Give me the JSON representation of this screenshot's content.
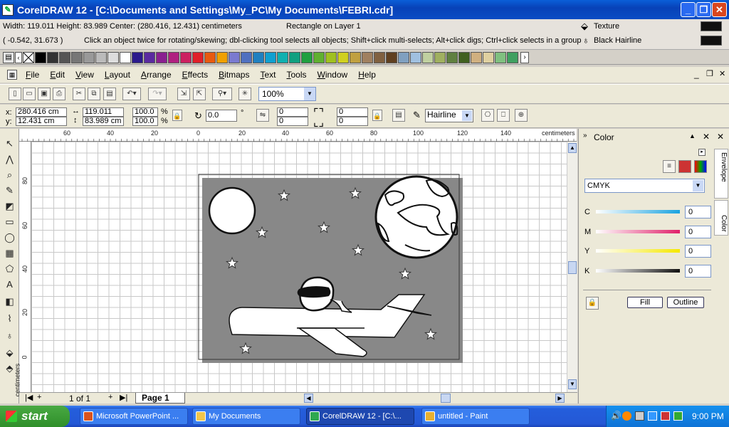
{
  "window": {
    "title": "CorelDRAW 12 - [C:\\Documents and Settings\\My_PC\\My Documents\\FEBRI.cdr]",
    "min": "_",
    "max": "❐",
    "close": "✕"
  },
  "status": {
    "dims": "Width: 119.011  Height: 83.989  Center: (280.416, 12.431)  centimeters",
    "layer": "Rectangle on Layer 1",
    "coords": "( -0.542, 31.673 )",
    "hint": "Click an object twice for rotating/skewing; dbl-clicking tool selects all objects; Shift+click multi-selects; Alt+click digs; Ctrl+click selects in a group",
    "fill_label": "Texture",
    "outline_label": "Black  Hairline"
  },
  "palette": {
    "colors": [
      "#000000",
      "#333333",
      "#555555",
      "#777777",
      "#999999",
      "#bbbbbb",
      "#dddddd",
      "#ffffff",
      "#2b1a8c",
      "#5a2aa0",
      "#8a2090",
      "#b02080",
      "#cc2060",
      "#e0202a",
      "#e85a10",
      "#f0a000",
      "#7a7ad0",
      "#5070c0",
      "#2080c0",
      "#10a0d0",
      "#10b0b0",
      "#10a080",
      "#20a040",
      "#60b030",
      "#a0c020",
      "#d0d020",
      "#c0a040",
      "#a08060",
      "#806040",
      "#604020",
      "#80a0c0",
      "#a0c0e0",
      "#c0d0a0",
      "#a0b060",
      "#608040",
      "#406020",
      "#d0b080",
      "#e0d0a0",
      "#80c080",
      "#40a060"
    ]
  },
  "menu": [
    "File",
    "Edit",
    "View",
    "Layout",
    "Arrange",
    "Effects",
    "Bitmaps",
    "Text",
    "Tools",
    "Window",
    "Help"
  ],
  "toolbar": {
    "zoom": "100%"
  },
  "propbar": {
    "x": "280.416 cm",
    "y": "12.431 cm",
    "w": "119.011 cm",
    "h": "83.989 cm",
    "sx": "100.0",
    "sy": "100.0",
    "pct": "%",
    "angle": "0.0",
    "deg": "°",
    "r1": "0",
    "r2": "0",
    "r3": "0",
    "r4": "0",
    "outline": "Hairline"
  },
  "ruler": {
    "unit": "centimeters",
    "h_ticks": [
      "60",
      "40",
      "20",
      "0",
      "20",
      "40",
      "60",
      "80",
      "100",
      "120",
      "140"
    ],
    "v_ticks": [
      "80",
      "60",
      "40",
      "20",
      "0"
    ],
    "v_unit": "centimeters"
  },
  "pagebar": {
    "page_count": "1 of 1",
    "page_tab": "Page 1"
  },
  "docker": {
    "title": "Color",
    "model": "CMYK",
    "channels": [
      {
        "name": "C",
        "value": "0"
      },
      {
        "name": "M",
        "value": "0"
      },
      {
        "name": "Y",
        "value": "0"
      },
      {
        "name": "K",
        "value": "0"
      }
    ],
    "fill_btn": "Fill",
    "outline_btn": "Outline",
    "tab_envelope": "Envelope",
    "tab_color": "Color"
  },
  "taskbar": {
    "start": "start",
    "tasks": [
      {
        "label": "Microsoft PowerPoint ...",
        "color": "#d9531e"
      },
      {
        "label": "My Documents",
        "color": "#f3c64a"
      },
      {
        "label": "CorelDRAW 12 - [C:\\...",
        "color": "#2fa84f"
      },
      {
        "label": "untitled - Paint",
        "color": "#e8b030"
      }
    ],
    "clock": "9:00 PM"
  }
}
